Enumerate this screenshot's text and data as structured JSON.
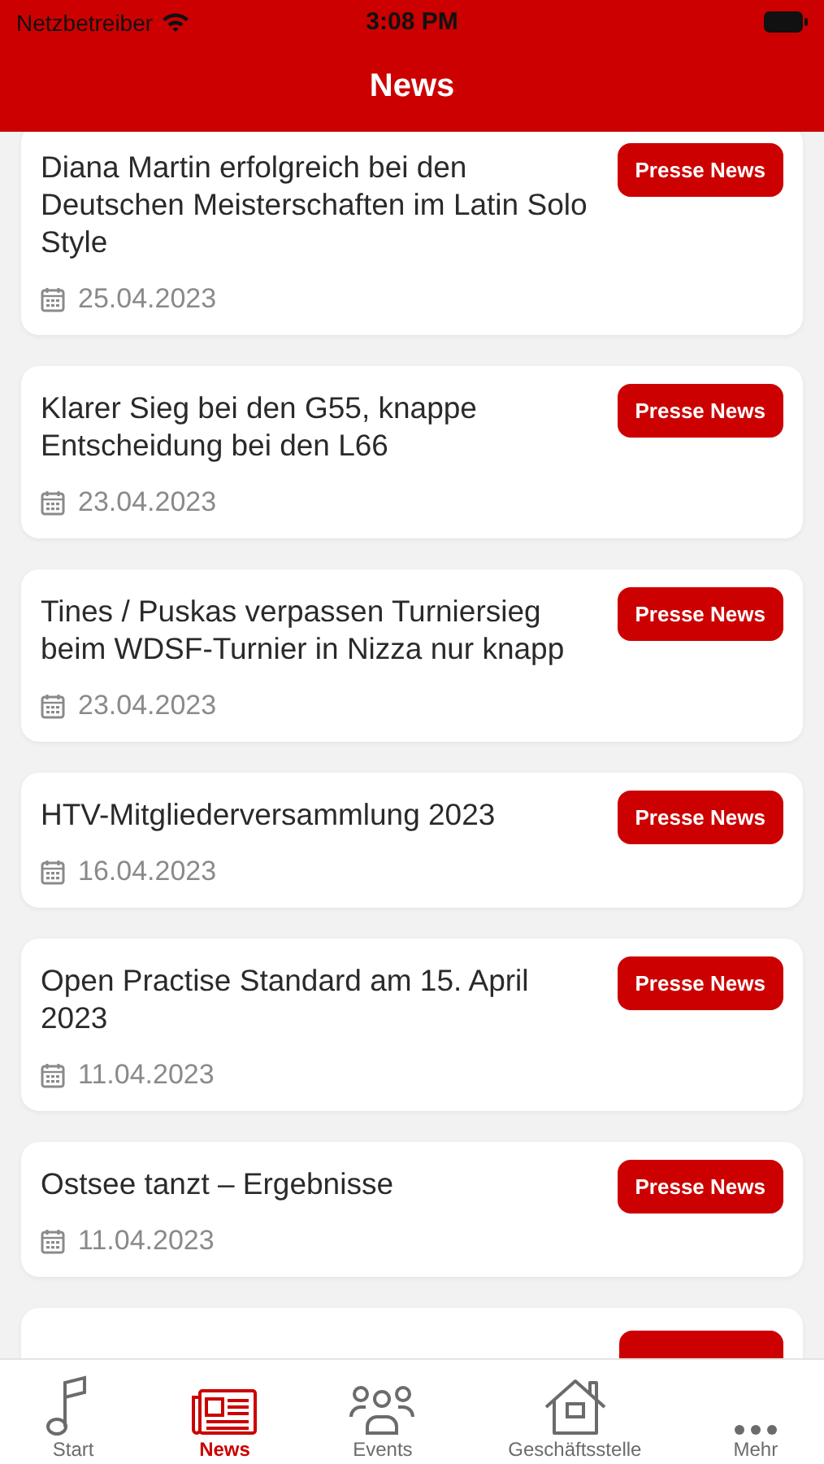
{
  "status_bar": {
    "carrier": "Netzbetreiber",
    "time": "3:08 PM"
  },
  "header": {
    "title": "News"
  },
  "news": [
    {
      "title": "Diana Martin erfolgreich bei den Deutschen Meisterschaften im Latin Solo Style",
      "date": "25.04.2023",
      "tag": "Presse News"
    },
    {
      "title": "Klarer Sieg bei den G55, knappe Entscheidung bei den L66",
      "date": "23.04.2023",
      "tag": "Presse News"
    },
    {
      "title": "Tines / Puskas verpassen Turniersieg beim WDSF-Turnier in Nizza nur knapp",
      "date": "23.04.2023",
      "tag": "Presse News"
    },
    {
      "title": "HTV-Mitgliederversammlung 2023",
      "date": "16.04.2023",
      "tag": "Presse News"
    },
    {
      "title": "Open Practise Standard am 15. April 2023",
      "date": "11.04.2023",
      "tag": "Presse News"
    },
    {
      "title": "Ostsee tanzt – Ergebnisse",
      "date": "11.04.2023",
      "tag": "Presse News"
    }
  ],
  "tab_bar": [
    {
      "label": "Start",
      "kind": "note",
      "selected": false
    },
    {
      "label": "News",
      "kind": "newspaper",
      "selected": true
    },
    {
      "label": "Events",
      "kind": "people",
      "selected": false
    },
    {
      "label": "Geschäftsstelle",
      "kind": "house",
      "selected": false
    },
    {
      "label": "Mehr",
      "kind": "dots",
      "selected": false
    }
  ]
}
